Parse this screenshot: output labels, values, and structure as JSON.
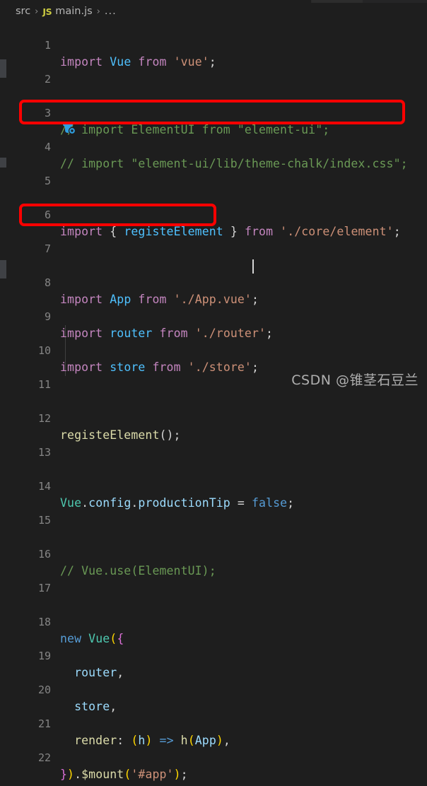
{
  "window": {
    "background": "#1e1e1e",
    "theme": "dark-plus"
  },
  "breadcrumb": {
    "folder": "src",
    "sep1": "›",
    "file_icon": "JS",
    "file": "main.js",
    "sep2": "›",
    "more": "..."
  },
  "editor": {
    "language": "javascript",
    "first_line": 1,
    "last_line": 22,
    "lines": [
      {
        "n": "1",
        "text": "import Vue from 'vue';"
      },
      {
        "n": "2",
        "text": ""
      },
      {
        "n": "3",
        "text": "// import ElementUI from \"element-ui\";"
      },
      {
        "n": "4",
        "text": "// import \"element-ui/lib/theme-chalk/index.css\";"
      },
      {
        "n": "5",
        "text": ""
      },
      {
        "n": "6",
        "text": "import { registeElement } from './core/element';"
      },
      {
        "n": "7",
        "text": ""
      },
      {
        "n": "8",
        "text": "import App from './App.vue';"
      },
      {
        "n": "9",
        "text": "import router from './router';"
      },
      {
        "n": "10",
        "text": "import store from './store';"
      },
      {
        "n": "11",
        "text": ""
      },
      {
        "n": "12",
        "text": "registeElement();"
      },
      {
        "n": "13",
        "text": ""
      },
      {
        "n": "14",
        "text": "Vue.config.productionTip = false;"
      },
      {
        "n": "15",
        "text": ""
      },
      {
        "n": "16",
        "text": "// Vue.use(ElementUI);"
      },
      {
        "n": "17",
        "text": ""
      },
      {
        "n": "18",
        "text": "new Vue({"
      },
      {
        "n": "19",
        "text": "  router,"
      },
      {
        "n": "20",
        "text": "  store,"
      },
      {
        "n": "21",
        "text": "  render: (h) => h(App),"
      },
      {
        "n": "22",
        "text": "}).$mount('#app');"
      }
    ],
    "tokens": {
      "l1": [
        "import",
        "Vue",
        "from",
        "'vue'",
        ";"
      ],
      "l3": [
        "// import ElementUI from \"element-ui\";"
      ],
      "l4": [
        "// import \"element-ui/lib/theme-chalk/index.css\";"
      ],
      "l6": [
        "import",
        "{",
        "registeElement",
        "}",
        "from",
        "'./core/element'",
        ";"
      ],
      "l8": [
        "import",
        "App",
        "from",
        "'./App.vue'",
        ";"
      ],
      "l9": [
        "import",
        "router",
        "from",
        "'./router'",
        ";"
      ],
      "l10": [
        "import",
        "store",
        "from",
        "'./store'",
        ";"
      ],
      "l12": [
        "registeElement",
        "()",
        ";"
      ],
      "l14": [
        "Vue",
        ".config",
        ".productionTip",
        "=",
        "false",
        ";"
      ],
      "l16": [
        "// Vue.use(ElementUI);"
      ],
      "l18": [
        "new",
        "Vue",
        "({"
      ],
      "l19": [
        "router",
        ","
      ],
      "l20": [
        "store",
        ","
      ],
      "l21": [
        "render",
        ":",
        "(h)",
        "=>",
        "h",
        "(App)",
        ","
      ],
      "l22": [
        "})",
        ".$mount",
        "(",
        "'#app'",
        ")",
        ";"
      ]
    }
  },
  "annotations": {
    "highlight_color": "#ff0000",
    "boxes": [
      {
        "label": "import-registe-element-highlight",
        "line": "6"
      },
      {
        "label": "registe-element-call-highlight",
        "line": "12"
      }
    ]
  },
  "icons": {
    "inline_hint": "mouse-cursor-icon",
    "inline_hint_color": "#2f9fe0"
  },
  "watermark": {
    "text": "CSDN @锥茎石豆兰"
  }
}
